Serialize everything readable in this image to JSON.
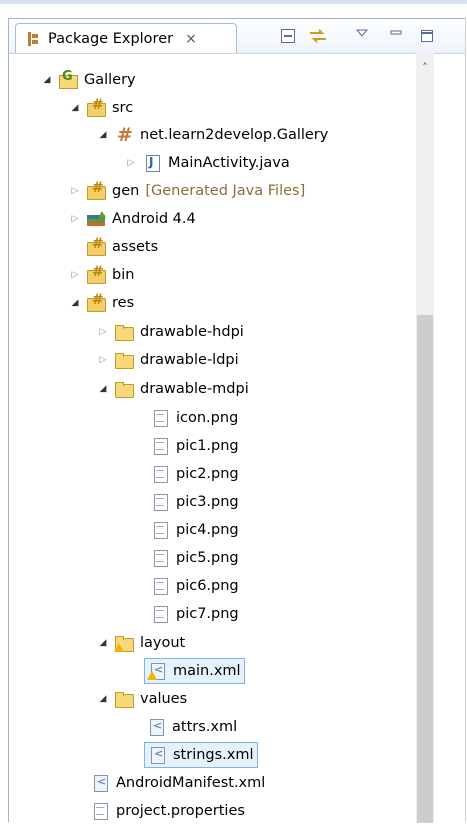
{
  "view": {
    "title": "Package Explorer",
    "close_glyph": "⨯",
    "toolbar": [
      "collapse-all-icon",
      "link-with-editor-icon",
      "view-menu-icon",
      "minimize-icon",
      "maximize-icon"
    ]
  },
  "tree": {
    "project": "Gallery",
    "src": "src",
    "package": "net.learn2develop.Gallery",
    "main_activity": "MainActivity.java",
    "gen": "gen",
    "gen_decoration": "[Generated Java Files]",
    "android_lib": "Android 4.4",
    "assets": "assets",
    "bin": "bin",
    "res": "res",
    "drawable_hdpi": "drawable-hdpi",
    "drawable_ldpi": "drawable-ldpi",
    "drawable_mdpi": "drawable-mdpi",
    "images": [
      "icon.png",
      "pic1.png",
      "pic2.png",
      "pic3.png",
      "pic4.png",
      "pic5.png",
      "pic6.png",
      "pic7.png"
    ],
    "layout": "layout",
    "main_xml": "main.xml",
    "values": "values",
    "attrs_xml": "attrs.xml",
    "strings_xml": "strings.xml",
    "manifest": "AndroidManifest.xml",
    "project_properties": "project.properties"
  }
}
